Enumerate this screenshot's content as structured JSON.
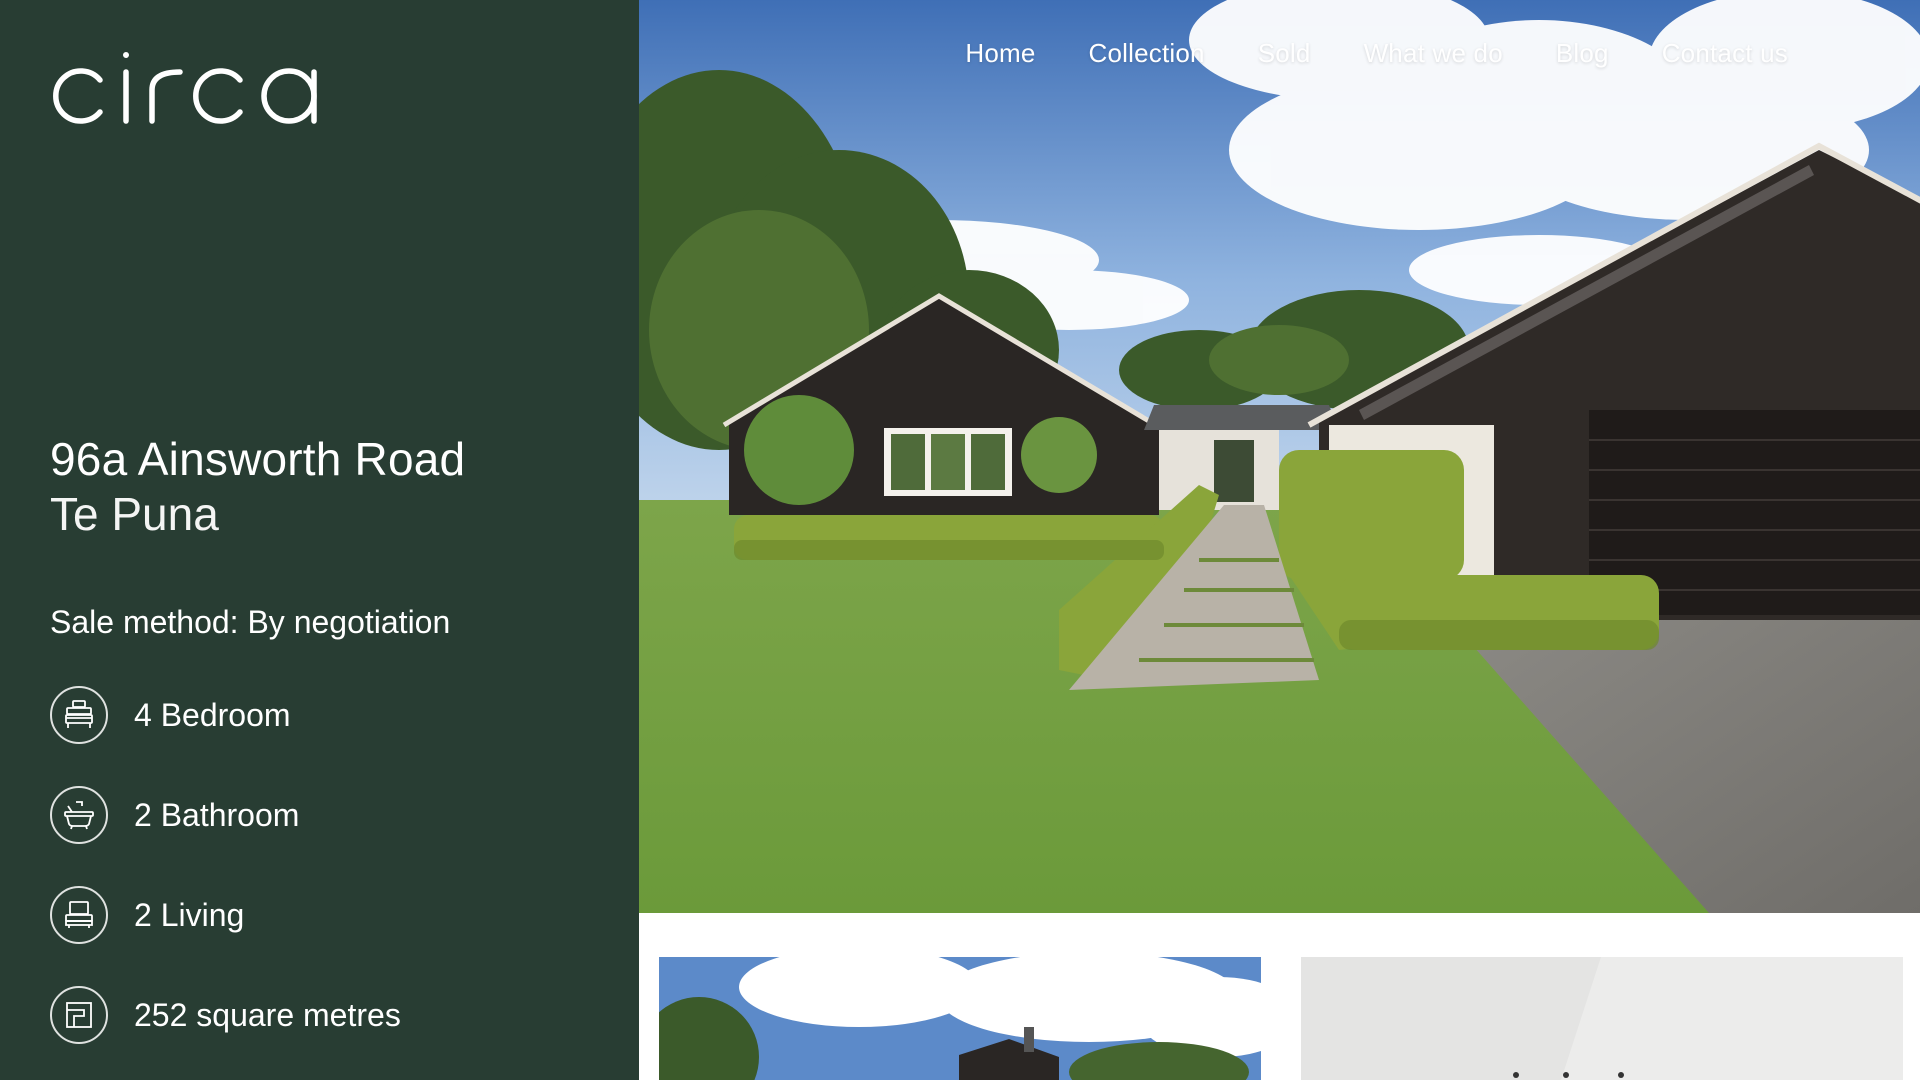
{
  "brand": {
    "logo_text": "circa"
  },
  "nav": {
    "items": [
      {
        "label": "Home"
      },
      {
        "label": "Collection"
      },
      {
        "label": "Sold"
      },
      {
        "label": "What we do"
      },
      {
        "label": "Blog"
      },
      {
        "label": "Contact us"
      }
    ]
  },
  "property": {
    "address_line1": "96a Ainsworth Road",
    "suburb": "Te Puna",
    "sale_method": "Sale method: By negotiation",
    "features": [
      {
        "icon": "bed-icon",
        "label": "4 Bedroom"
      },
      {
        "icon": "bath-icon",
        "label": "2 Bathroom"
      },
      {
        "icon": "sofa-icon",
        "label": "2 Living"
      },
      {
        "icon": "floorplan-icon",
        "label": "252 square metres"
      }
    ]
  },
  "colors": {
    "sidebar_bg": "#283d33",
    "text": "#ffffff"
  }
}
